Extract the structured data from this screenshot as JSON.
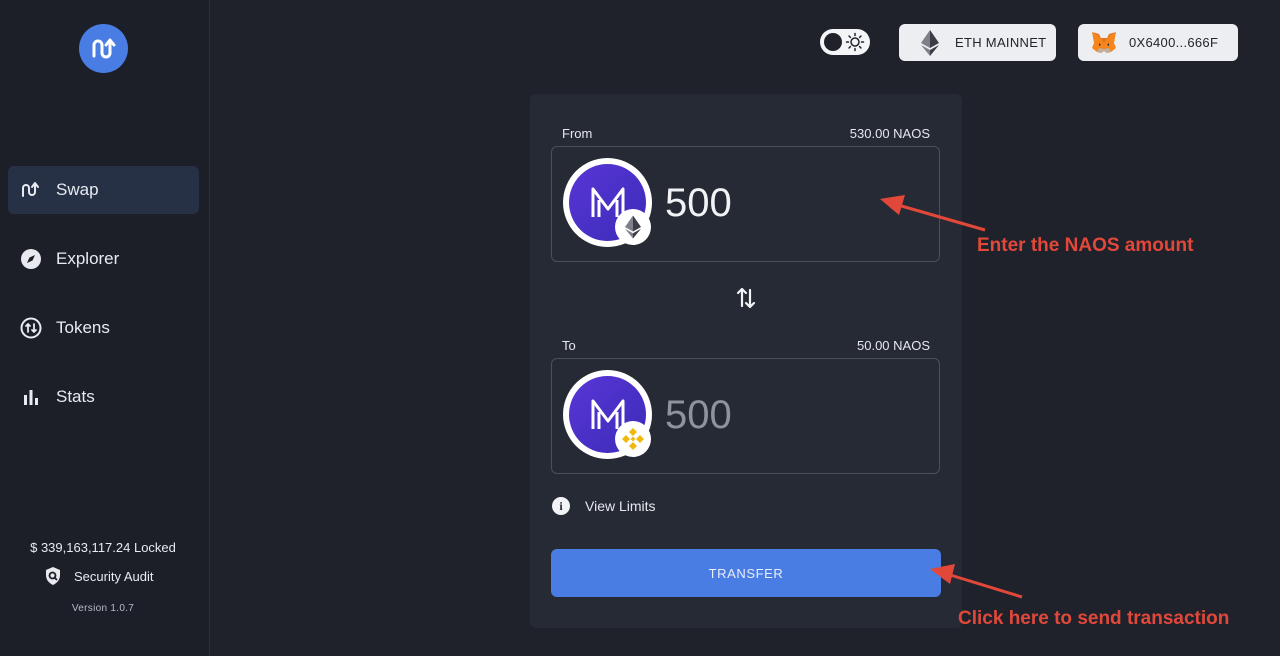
{
  "sidebar": {
    "logo": "swap-logo-icon",
    "items": [
      {
        "label": "Swap",
        "icon": "swap-icon",
        "active": true
      },
      {
        "label": "Explorer",
        "icon": "compass-icon",
        "active": false
      },
      {
        "label": "Tokens",
        "icon": "tokens-icon",
        "active": false
      },
      {
        "label": "Stats",
        "icon": "bar-chart-icon",
        "active": false
      }
    ],
    "locked": "$ 339,163,117.24 Locked",
    "audit": "Security Audit",
    "version": "Version 1.0.7"
  },
  "topbar": {
    "theme_toggle": "sun-icon",
    "network": "ETH MAINNET",
    "wallet": "0X6400...666F"
  },
  "swap": {
    "from_label": "From",
    "from_balance": "530.00 NAOS",
    "from_amount": "500",
    "to_label": "To",
    "to_balance": "50.00 NAOS",
    "to_amount_placeholder": "500",
    "view_limits": "View Limits",
    "transfer": "TRANSFER"
  },
  "annotations": {
    "enter_amount": "Enter the NAOS amount",
    "click_here": "Click here to send transaction"
  },
  "colors": {
    "background": "#1f222b",
    "card": "#262a34",
    "accent": "#4a7de4",
    "annotation": "#e2483a"
  }
}
